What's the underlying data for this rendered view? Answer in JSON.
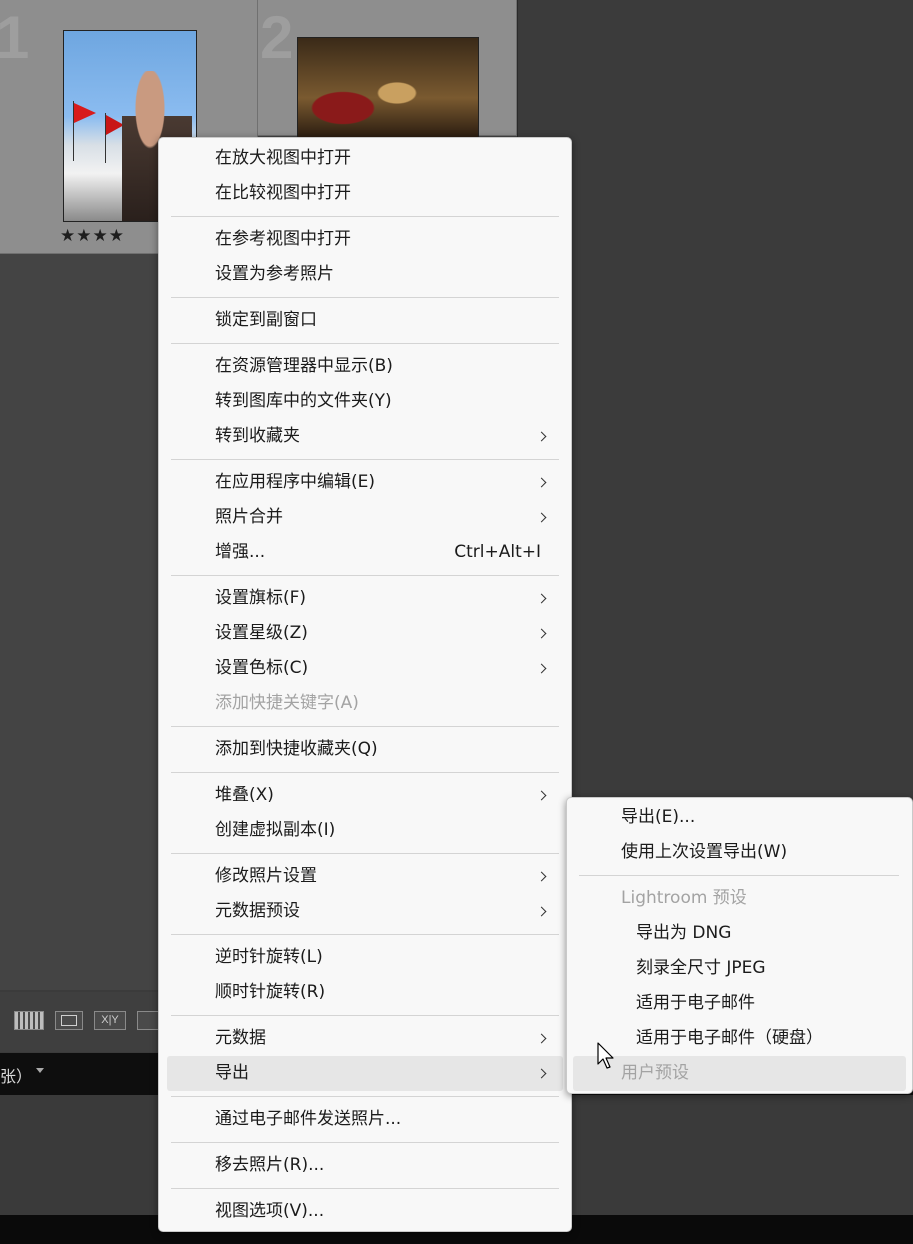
{
  "grid": {
    "cells": [
      {
        "number": "1",
        "rating": "★★★★"
      },
      {
        "number": "2"
      }
    ]
  },
  "toolbar": {
    "grid_view_icon": "grid-view-icon",
    "loupe_view_icon": "loupe-view-icon",
    "compare_label": "X|Y",
    "survey_view_icon": "survey-view-icon"
  },
  "filmstrip": {
    "label": "张）"
  },
  "context_menu": {
    "items": [
      {
        "label": "在放大视图中打开"
      },
      {
        "label": "在比较视图中打开"
      },
      {
        "label": "在参考视图中打开"
      },
      {
        "label": "设置为参考照片"
      },
      {
        "label": "锁定到副窗口"
      },
      {
        "label": "在资源管理器中显示(B)"
      },
      {
        "label": "转到图库中的文件夹(Y)"
      },
      {
        "label": "转到收藏夹",
        "submenu": true
      },
      {
        "label": "在应用程序中编辑(E)",
        "submenu": true
      },
      {
        "label": "照片合并",
        "submenu": true
      },
      {
        "label": "增强...",
        "shortcut": "Ctrl+Alt+I"
      },
      {
        "label": "设置旗标(F)",
        "submenu": true
      },
      {
        "label": "设置星级(Z)",
        "submenu": true
      },
      {
        "label": "设置色标(C)",
        "submenu": true
      },
      {
        "label": "添加快捷关键字(A)",
        "disabled": true
      },
      {
        "label": "添加到快捷收藏夹(Q)"
      },
      {
        "label": "堆叠(X)",
        "submenu": true
      },
      {
        "label": "创建虚拟副本(I)"
      },
      {
        "label": "修改照片设置",
        "submenu": true
      },
      {
        "label": "元数据预设",
        "submenu": true
      },
      {
        "label": "逆时针旋转(L)"
      },
      {
        "label": "顺时针旋转(R)"
      },
      {
        "label": "元数据",
        "submenu": true
      },
      {
        "label": "导出",
        "submenu": true,
        "highlighted": true
      },
      {
        "label": "通过电子邮件发送照片..."
      },
      {
        "label": "移去照片(R)..."
      },
      {
        "label": "视图选项(V)..."
      }
    ]
  },
  "export_submenu": {
    "items": [
      {
        "label": "导出(E)..."
      },
      {
        "label": "使用上次设置导出(W)"
      },
      {
        "label": "Lightroom 预设",
        "disabled": true,
        "header": true
      },
      {
        "label": "导出为 DNG"
      },
      {
        "label": "刻录全尺寸 JPEG"
      },
      {
        "label": "适用于电子邮件"
      },
      {
        "label": "适用于电子邮件（硬盘）"
      },
      {
        "label": "用户预设",
        "disabled": true,
        "header": true
      }
    ]
  },
  "colors": {
    "menu_bg": "#f8f8f8",
    "menu_text": "#1b1b1b",
    "disabled_text": "#a3a3a3",
    "highlight_bg": "#e6e6e6",
    "app_bg": "#3b3b3b"
  },
  "cursor_icon": "mouse-pointer-icon"
}
